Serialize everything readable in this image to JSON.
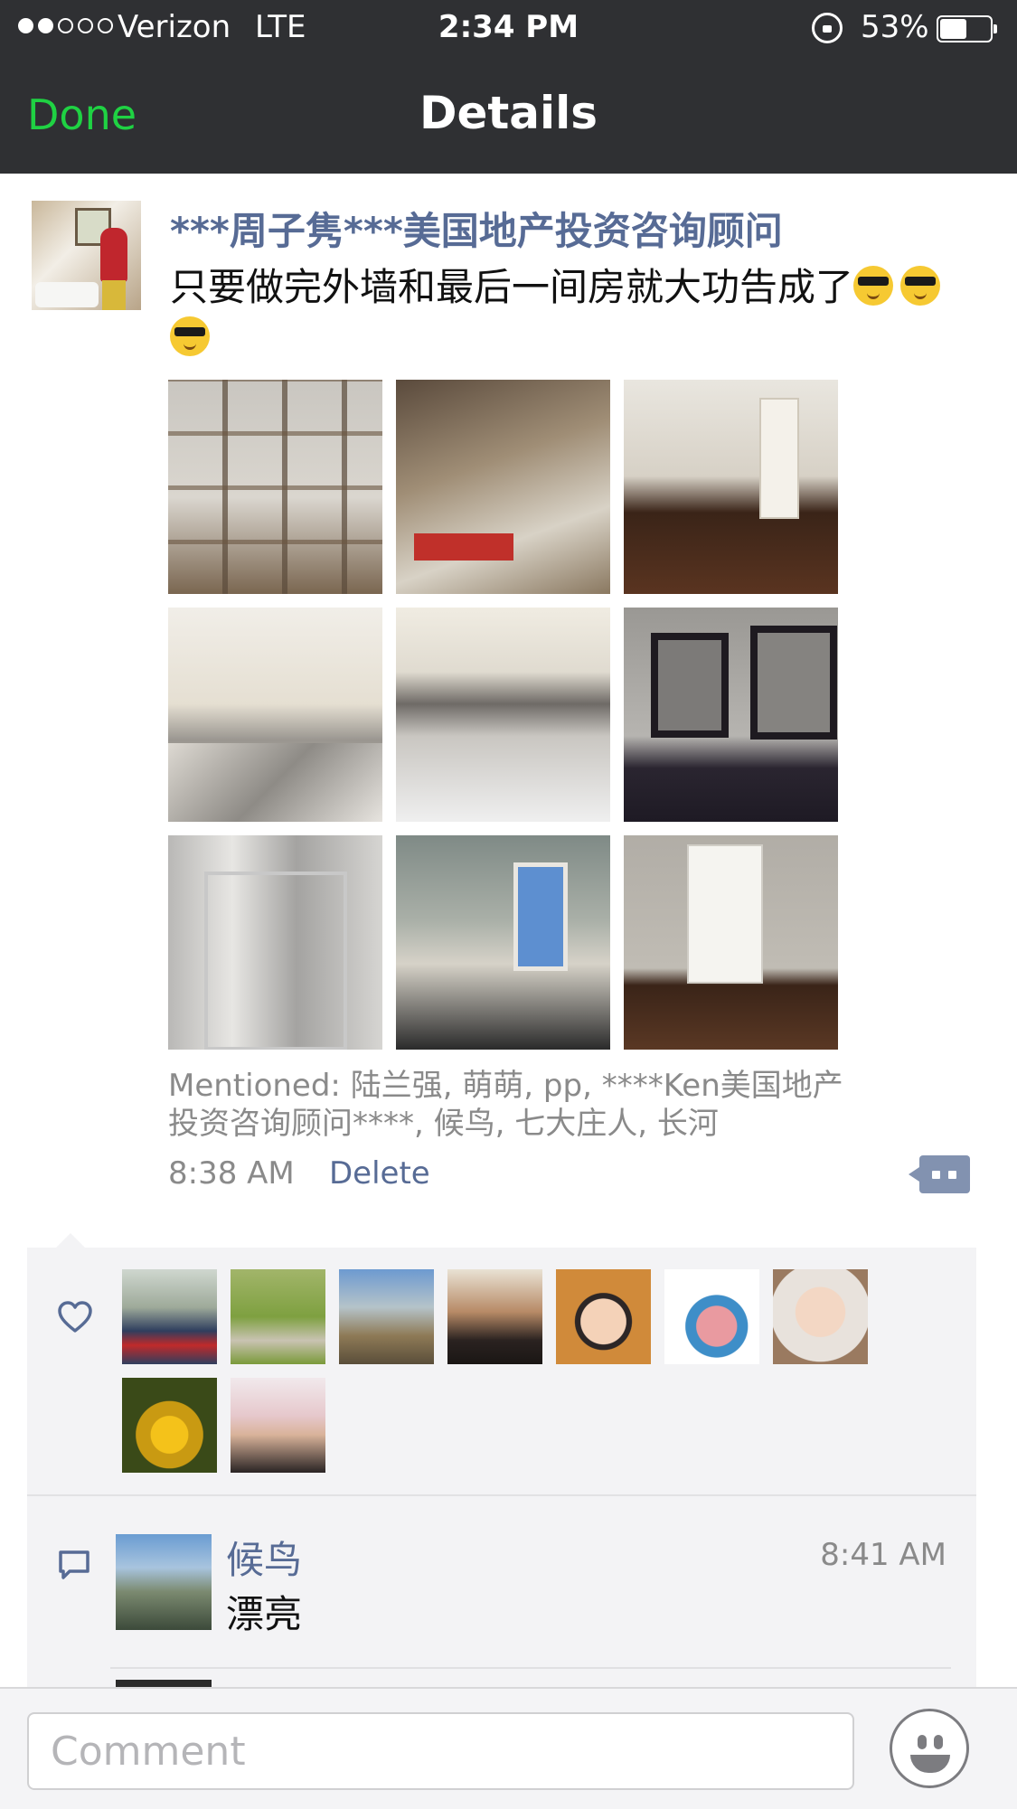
{
  "status_bar": {
    "carrier": "Verizon",
    "network": "LTE",
    "time": "2:34 PM",
    "battery_pct": "53%",
    "battery_level": 0.53,
    "signal_bars_filled": 2,
    "signal_bars_total": 5
  },
  "nav": {
    "done_label": "Done",
    "title": "Details"
  },
  "post": {
    "author": "***周子隽***美国地产投资咨询顾问",
    "text": "只要做完外墙和最后一间房就大功告成了",
    "emoji_count": 3,
    "emoji_icon": "sunglasses-emoji",
    "photo_count": 9,
    "mentioned": "Mentioned: 陆兰强, 萌萌, pp, ****Ken美国地产投资咨询顾问****, 候鸟, 七大庄人, 长河",
    "time": "8:38 AM",
    "delete_label": "Delete"
  },
  "likes": {
    "icon": "heart-icon",
    "count": 9
  },
  "comments": [
    {
      "name": "候鸟",
      "time": "8:41 AM",
      "text": "漂亮"
    }
  ],
  "input": {
    "placeholder": "Comment"
  },
  "colors": {
    "bar_background": "#2f3033",
    "done_green": "#1fd243",
    "link_blue": "#576b95",
    "meta_gray": "#8a8a8a",
    "panel_gray": "#f3f3f5"
  }
}
